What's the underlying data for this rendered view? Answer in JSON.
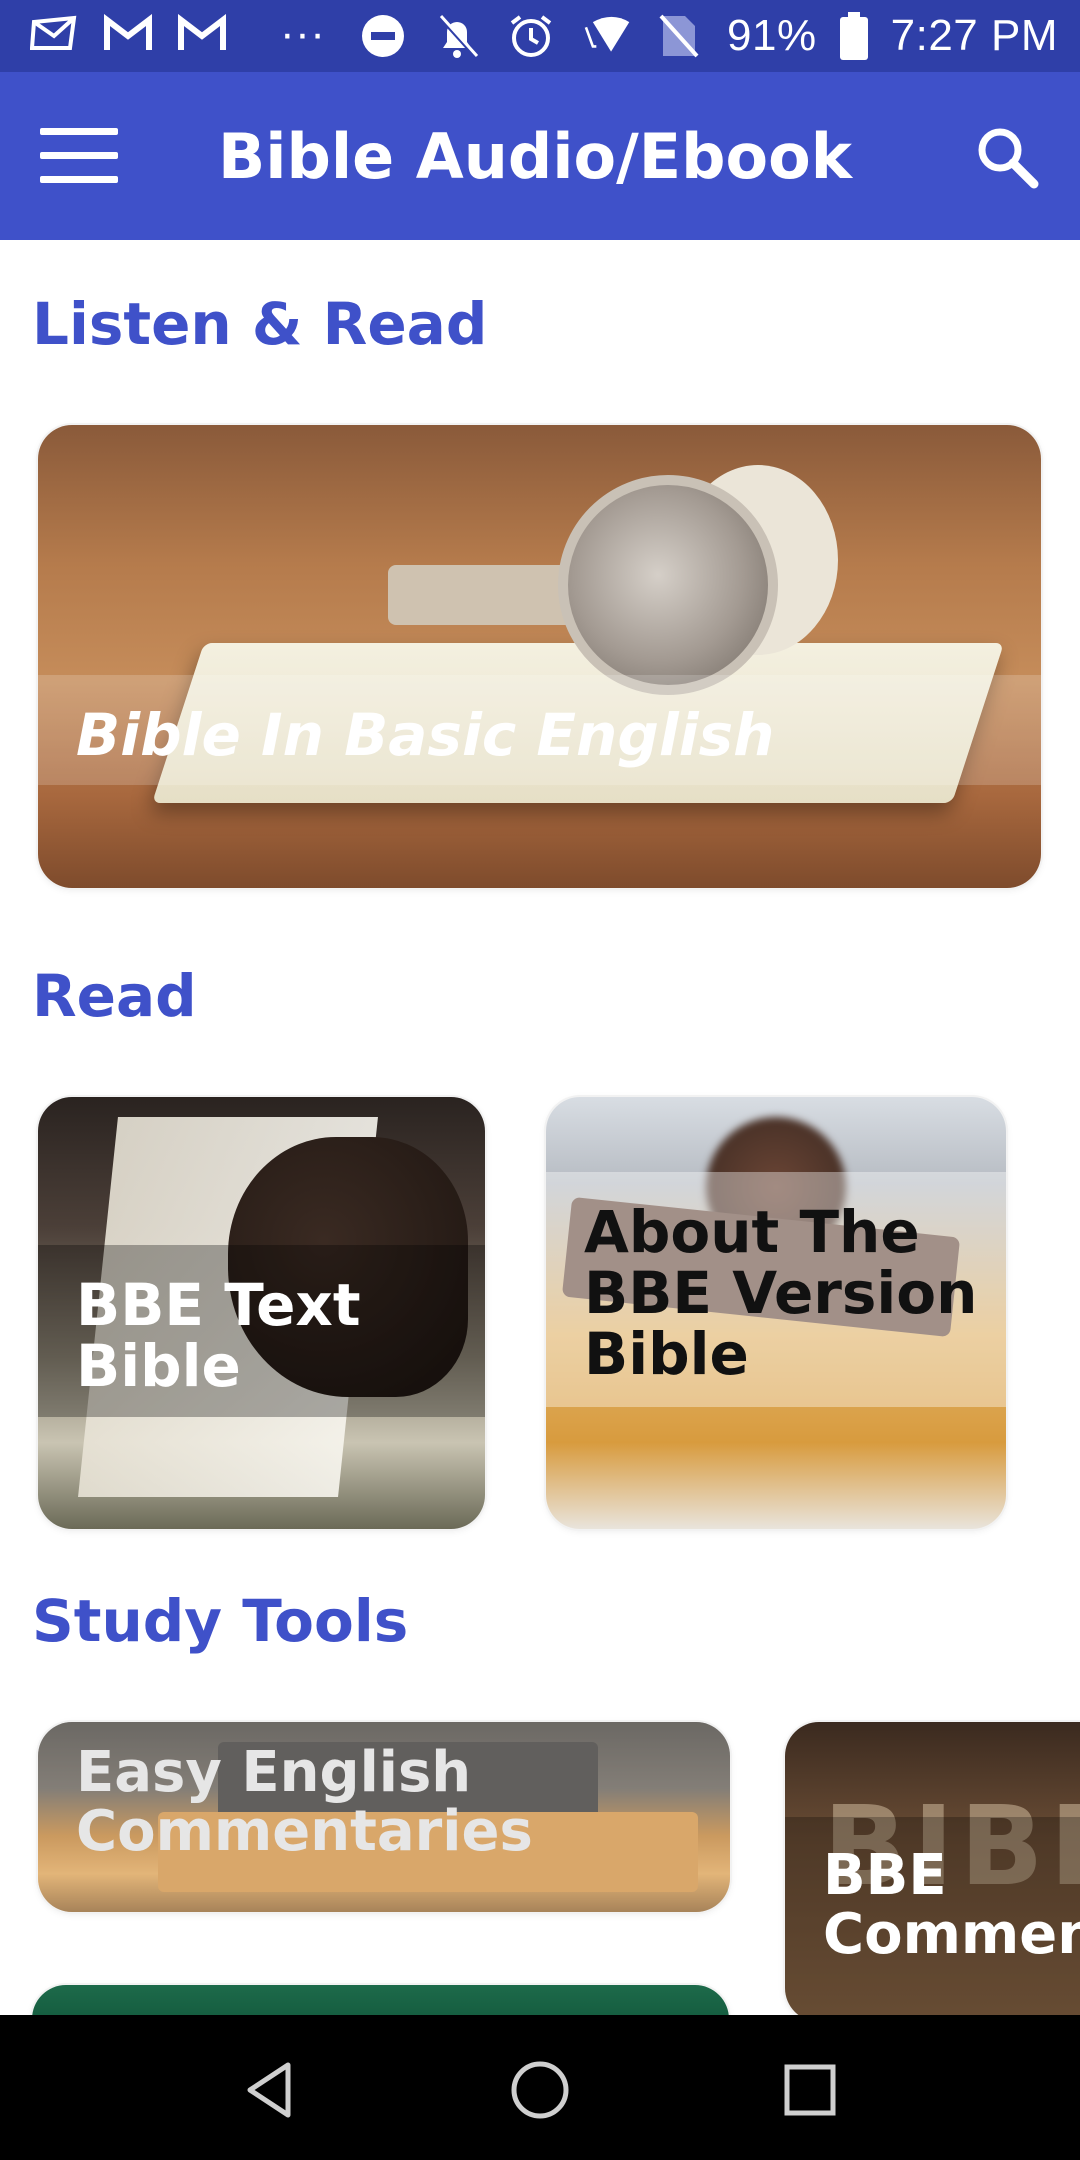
{
  "status_bar": {
    "notification_icons": [
      "email-icon",
      "gmail-icon",
      "gmail-icon",
      "more-dots-icon"
    ],
    "more": "···",
    "status_icons": [
      "do-not-disturb-icon",
      "notifications-off-icon",
      "alarm-icon",
      "wifi-icon",
      "no-sim-icon",
      "battery-icon"
    ],
    "battery": "91%",
    "time": "7:27 PM"
  },
  "app_bar": {
    "title": "Bible Audio/Ebook",
    "menu_icon": "hamburger-menu-icon",
    "search_icon": "search-icon"
  },
  "sections": {
    "listen_read": "Listen & Read",
    "read": "Read",
    "study_tools": "Study Tools"
  },
  "cards": {
    "bible_basic_english": "Bible In Basic English",
    "bbe_text_bible": [
      "BBE Text",
      "Bible"
    ],
    "about_bbe": [
      "About The",
      "BBE Version",
      "Bible"
    ],
    "easy_english": [
      "Easy English",
      "Commentaries"
    ],
    "bbe_commentary": [
      "BBE",
      "Comment"
    ]
  },
  "card_image_text": {
    "bible_study": "BIBL"
  },
  "nav": {
    "back_icon": "back-triangle-icon",
    "home_icon": "home-circle-icon",
    "recents_icon": "recents-square-icon"
  }
}
